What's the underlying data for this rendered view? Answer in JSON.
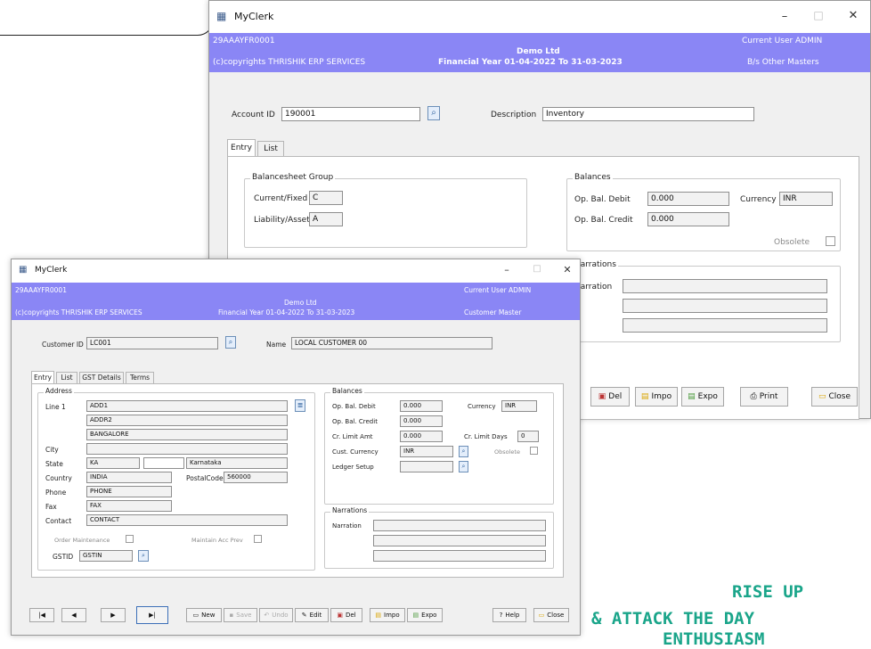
{
  "back": {
    "title": "MyClerk",
    "controls": {
      "min": "–",
      "max": "□",
      "close": "✕"
    },
    "band": {
      "code": "29AAAYFR0001",
      "copyright": "(c)copyrights THRISHIK ERP SERVICES",
      "company": "Demo Ltd",
      "fy": "Financial Year 01-04-2022 To 31-03-2023",
      "user": "Current User ADMIN",
      "module": "B/s Other Masters"
    },
    "account_id_label": "Account ID",
    "account_id": "190001",
    "description_label": "Description",
    "description": "Inventory",
    "tabs": [
      "Entry",
      "List"
    ],
    "bs_group": {
      "title": "Balancesheet Group",
      "current_fixed_label": "Current/Fixed",
      "current_fixed": "C",
      "liability_asset_label": "Liability/Asset",
      "liability_asset": "A"
    },
    "balances": {
      "title": "Balances",
      "op_debit_label": "Op. Bal. Debit",
      "op_debit": "0.000",
      "op_credit_label": "Op. Bal. Credit",
      "op_credit": "0.000",
      "currency_label": "Currency",
      "currency": "INR",
      "obsolete_label": "Obsolete"
    },
    "narrations": {
      "title": "Narrations",
      "narration_label": "Narration"
    },
    "buttons": {
      "del": "Del",
      "impo": "Impo",
      "expo": "Expo",
      "print": "Print",
      "close": "Close"
    }
  },
  "front": {
    "title": "MyClerk",
    "controls": {
      "min": "–",
      "max": "□",
      "close": "✕"
    },
    "band": {
      "code": "29AAAYFR0001",
      "copyright": "(c)copyrights THRISHIK ERP SERVICES",
      "company": "Demo Ltd",
      "fy": "Financial Year 01-04-2022 To 31-03-2023",
      "user": "Current User ADMIN",
      "module": "Customer Master"
    },
    "customer_id_label": "Customer ID",
    "customer_id": "LC001",
    "name_label": "Name",
    "name": "LOCAL CUSTOMER 00",
    "tabs": [
      "Entry",
      "List",
      "GST Details",
      "Terms"
    ],
    "address": {
      "title": "Address",
      "line1_label": "Line 1",
      "line1": "ADD1",
      "line2": "ADDR2",
      "line3": "BANGALORE",
      "city_label": "City",
      "state_label": "State",
      "state_code": "KA",
      "state_name": "Karnataka",
      "country_label": "Country",
      "country": "INDIA",
      "postal_label": "PostalCode",
      "postal": "560000",
      "phone_label": "Phone",
      "phone": "PHONE",
      "fax_label": "Fax",
      "fax": "FAX",
      "contact_label": "Contact",
      "contact": "CONTACT",
      "order_label": "Order Maintenance",
      "maintain_label": "Maintain Acc Prev",
      "gstid_label": "GSTID",
      "gstid": "GSTIN"
    },
    "balances": {
      "title": "Balances",
      "op_debit_label": "Op. Bal. Debit",
      "op_debit": "0.000",
      "op_credit_label": "Op. Bal. Credit",
      "op_credit": "0.000",
      "cr_limit_amt_label": "Cr. Limit Amt",
      "cr_limit_amt": "0.000",
      "cr_limit_days_label": "Cr. Limit Days",
      "cr_limit_days": "0",
      "cust_currency_label": "Cust. Currency",
      "cust_currency": "INR",
      "currency_label": "Currency",
      "currency": "INR",
      "obsolete_label": "Obsolete",
      "ledger_setup_label": "Ledger Setup"
    },
    "narrations": {
      "title": "Narrations",
      "narration_label": "Narration"
    },
    "nav": {
      "first": "|◀",
      "prev": "◀",
      "next": "▶",
      "last": "▶|"
    },
    "buttons": {
      "new": "New",
      "save": "Save",
      "undo": "Undo",
      "edit": "Edit",
      "del": "Del",
      "impo": "Impo",
      "expo": "Expo",
      "help": "Help",
      "close": "Close"
    }
  },
  "slogan": {
    "line1": "RISE UP",
    "line2": "& ATTACK  THE DAY",
    "line3": "ENTHUSIASM"
  },
  "colors": {
    "header_band": "#8a86f5",
    "slogan": "#1aa58a",
    "window_bg": "#f0f0f0"
  }
}
